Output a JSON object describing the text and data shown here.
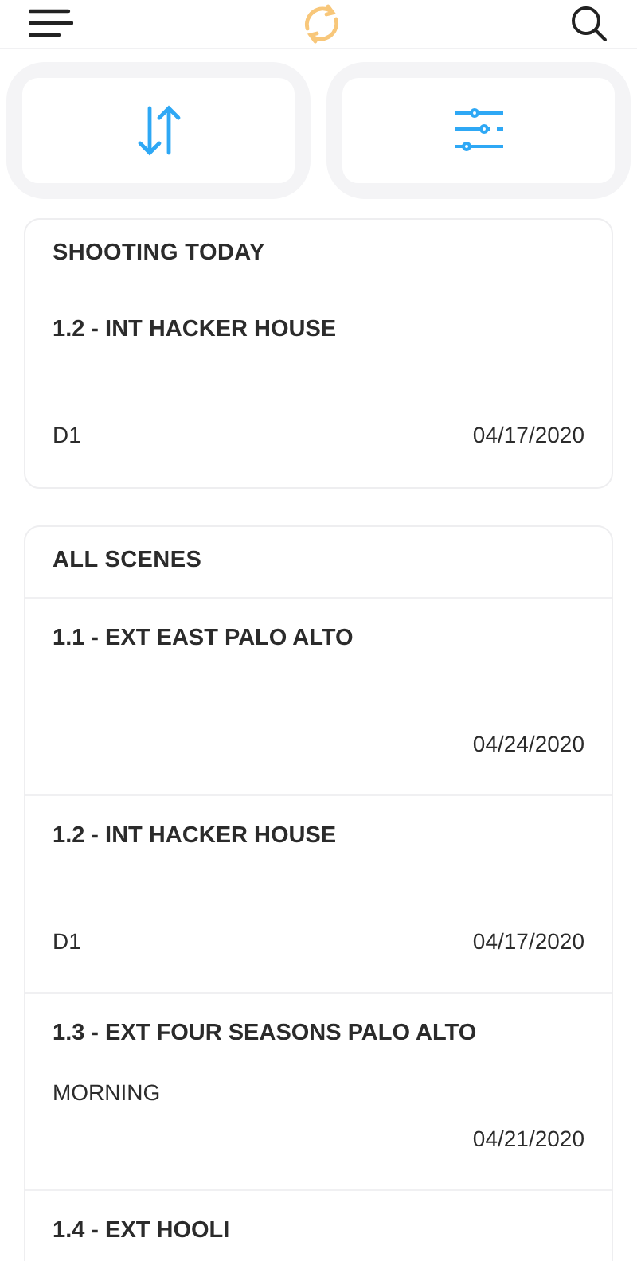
{
  "today": {
    "title": "SHOOTING TODAY",
    "scenes": [
      {
        "title": "1.2 - INT HACKER HOUSE",
        "detail": "D1",
        "date": "04/17/2020"
      }
    ]
  },
  "all": {
    "title": "ALL SCENES",
    "scenes": [
      {
        "title": "1.1 - EXT EAST PALO ALTO",
        "date": "04/24/2020"
      },
      {
        "title": "1.2 - INT HACKER HOUSE",
        "detail": "D1",
        "date": "04/17/2020"
      },
      {
        "title": "1.3 - EXT FOUR SEASONS PALO ALTO",
        "subtitle": "MORNING",
        "date": "04/21/2020"
      },
      {
        "title": "1.4 - EXT HOOLI"
      }
    ]
  }
}
